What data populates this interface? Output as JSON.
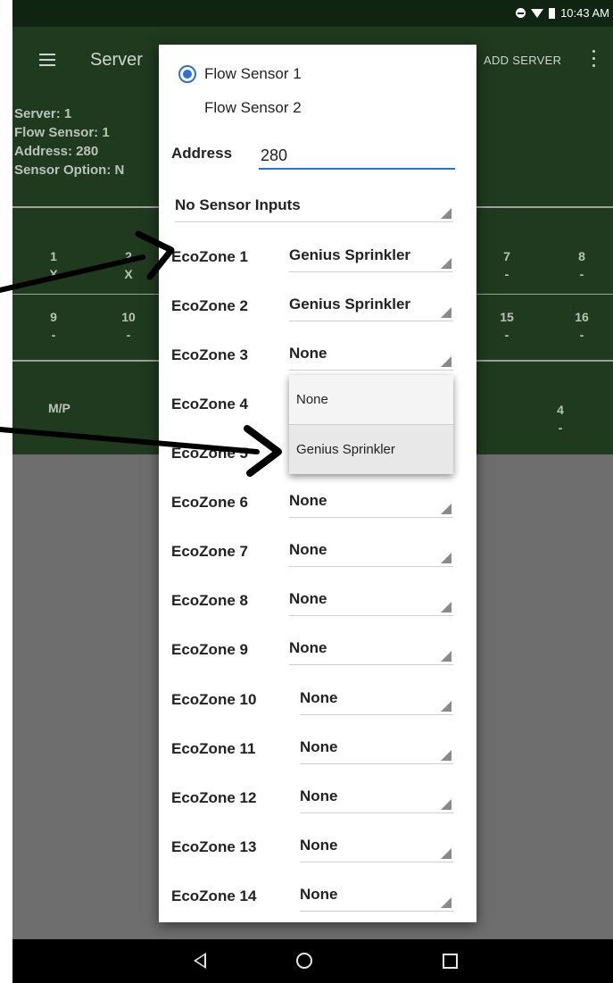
{
  "status_bar": {
    "time": "10:43 AM"
  },
  "app_bar": {
    "title": "Server",
    "add_server": "ADD SERVER"
  },
  "background": {
    "info": [
      "Server: 1",
      "Flow Sensor: 1",
      "Address: 280",
      "Sensor Option: N"
    ],
    "row1": [
      {
        "num": "1",
        "val": "X"
      },
      {
        "num": "2",
        "val": "X"
      },
      {
        "num": "7",
        "val": "-"
      },
      {
        "num": "8",
        "val": "-"
      }
    ],
    "row2": [
      {
        "num": "9",
        "val": "-"
      },
      {
        "num": "10",
        "val": "-"
      },
      {
        "num": "15",
        "val": "-"
      },
      {
        "num": "16",
        "val": "-"
      }
    ],
    "mp_label": "M/P",
    "row3": {
      "num": "4",
      "val": "-"
    }
  },
  "dialog": {
    "flow_sensors": [
      {
        "label": "Flow Sensor 1",
        "selected": true
      },
      {
        "label": "Flow Sensor 2",
        "selected": false
      }
    ],
    "address_label": "Address",
    "address_value": "280",
    "sensor_option": "No Sensor Inputs",
    "ecozones": [
      {
        "label": "EcoZone 1",
        "value": "Genius Sprinkler"
      },
      {
        "label": "EcoZone 2",
        "value": "Genius Sprinkler"
      },
      {
        "label": "EcoZone 3",
        "value": "None"
      },
      {
        "label": "EcoZone 4",
        "value": ""
      },
      {
        "label": "EcoZone 5",
        "value": ""
      },
      {
        "label": "EcoZone 6",
        "value": "None"
      },
      {
        "label": "EcoZone 7",
        "value": "None"
      },
      {
        "label": "EcoZone 8",
        "value": "None"
      },
      {
        "label": "EcoZone 9",
        "value": "None"
      },
      {
        "label": "EcoZone 10",
        "value": "None"
      },
      {
        "label": "EcoZone 11",
        "value": "None"
      },
      {
        "label": "EcoZone 12",
        "value": "None"
      },
      {
        "label": "EcoZone 13",
        "value": "None"
      },
      {
        "label": "EcoZone 14",
        "value": "None"
      }
    ],
    "dropdown_options": [
      "None",
      "Genius Sprinkler"
    ]
  }
}
